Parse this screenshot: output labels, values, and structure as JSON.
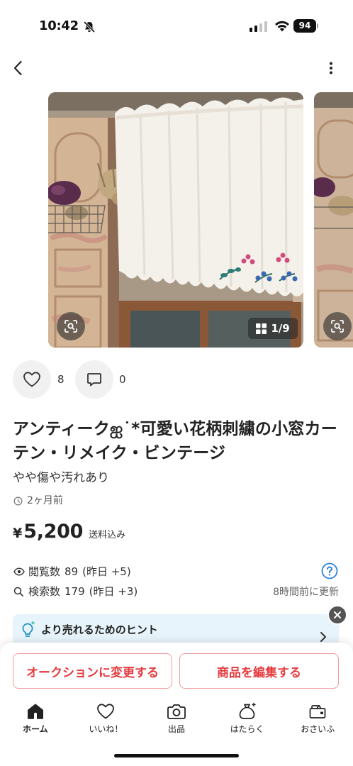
{
  "status_bar": {
    "time": "10:42",
    "battery": "94",
    "icons": [
      "bell-slash-icon",
      "signal-icon",
      "wifi-icon",
      "battery-icon"
    ]
  },
  "nav": {
    "icons": [
      "back-chevron-icon",
      "more-vertical-icon"
    ]
  },
  "carousel": {
    "counter": "1/9",
    "icons": [
      "image-search-icon",
      "grid-icon"
    ]
  },
  "engagement": {
    "likes": "8",
    "comments": "0",
    "icons": [
      "heart-icon",
      "comment-icon"
    ]
  },
  "item": {
    "title": "アンティークஐ˙*可愛い花柄刺繍の小窓カーテン・リメイク・ビンテージ",
    "condition": "やや傷や汚れあり",
    "posted": "2ヶ月前",
    "price": {
      "currency": "¥",
      "amount": "5,200",
      "shipping": "送料込み"
    }
  },
  "stats": {
    "views": {
      "label": "閲覧数",
      "count": "89",
      "delta": "(昨日 +5)"
    },
    "searches": {
      "label": "検索数",
      "count": "179",
      "delta": "(昨日 +3)"
    },
    "updated": "8時間前に更新"
  },
  "hint": {
    "text": "より売れるためのヒント",
    "icons": [
      "lightbulb-icon",
      "chevron-right-icon",
      "close-icon"
    ]
  },
  "actions": {
    "auction": "オークションに変更する",
    "edit": "商品を編集する"
  },
  "tabs": [
    {
      "label": "ホーム",
      "icon": "home-icon",
      "active": true
    },
    {
      "label": "いいね！",
      "icon": "heart-icon",
      "active": false
    },
    {
      "label": "出品",
      "icon": "camera-icon",
      "active": false
    },
    {
      "label": "はたらく",
      "icon": "money-bag-icon",
      "active": false
    },
    {
      "label": "おさいふ",
      "icon": "wallet-icon",
      "active": false
    }
  ],
  "colors": {
    "accent_red": "#e53b3f",
    "button_border": "#f19a9e",
    "help_blue": "#2f84d8",
    "hint_background": "#e7f4fb",
    "text_primary": "#222222"
  }
}
